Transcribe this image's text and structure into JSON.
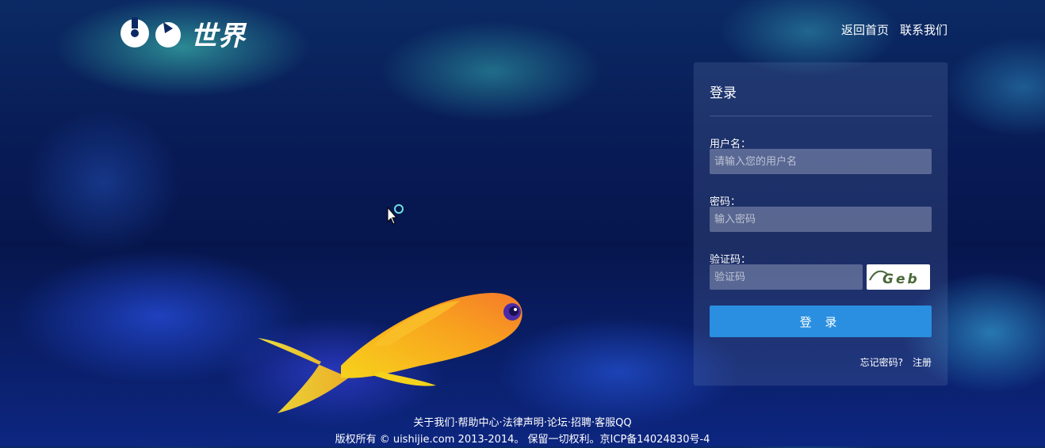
{
  "logo": {
    "text": "世界"
  },
  "top_nav": {
    "home": "返回首页",
    "contact": "联系我们"
  },
  "login": {
    "title": "登录",
    "username_label": "用户名：",
    "username_placeholder": "请输入您的用户名",
    "password_label": "密码：",
    "password_placeholder": "输入密码",
    "captcha_label": "验证码：",
    "captcha_placeholder": "验证码",
    "captcha_text": "Geb",
    "button": "登 录",
    "forgot": "忘记密码?",
    "register": "注册"
  },
  "footer": {
    "links": [
      "关于我们",
      "帮助中心",
      "法律声明",
      "论坛",
      "招聘",
      "客服QQ"
    ],
    "separator": "·",
    "copyright": "版权所有 © uishijie.com 2013-2014。 保留一切权利。京ICP备14024830号-4"
  },
  "colors": {
    "accent": "#2a8fe0",
    "background": "#081a55"
  }
}
